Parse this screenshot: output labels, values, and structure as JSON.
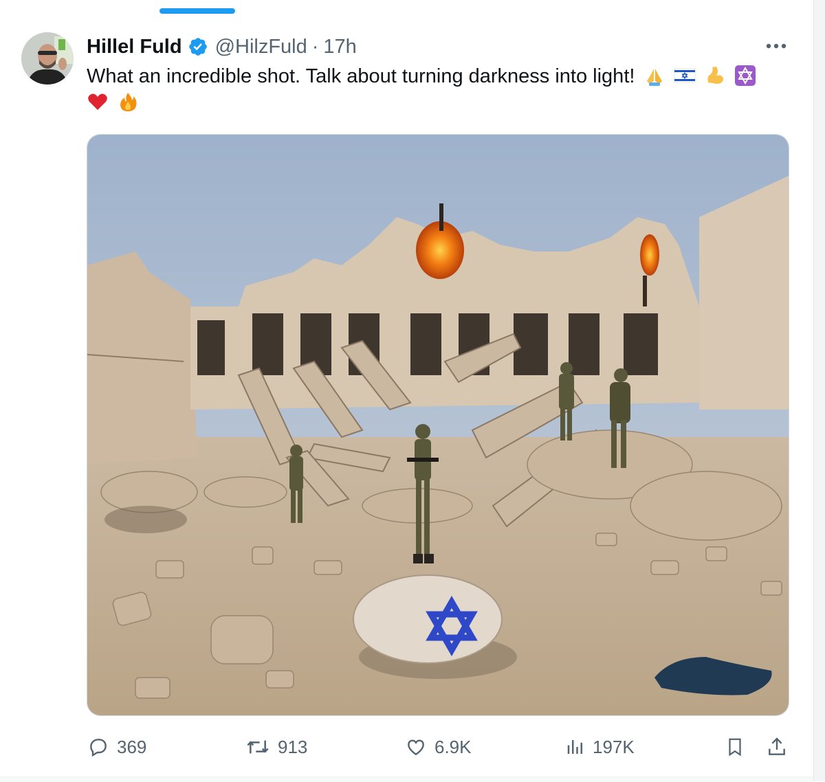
{
  "tweet": {
    "author_name": "Hillel Fuld",
    "handle": "@HilzFuld",
    "separator": "·",
    "time": "17h",
    "text": "What an incredible shot. Talk about turning darkness into light!",
    "emojis": [
      "folded-hands-emoji",
      "israel-flag-emoji",
      "flexed-biceps-emoji",
      "star-of-david-emoji",
      "red-heart-emoji",
      "fire-emoji"
    ],
    "image_alt": "Ruined building with soldiers standing in rubble and a rock painted with a blue Star of David"
  },
  "actions": {
    "replies": "369",
    "reposts": "913",
    "likes": "6.9K",
    "views": "197K"
  },
  "colors": {
    "accent": "#1d9bf0",
    "text_primary": "#0f1419",
    "text_secondary": "#536471",
    "border": "#cfd9de"
  },
  "icons": {
    "verified": "verified-badge-icon",
    "more": "more-icon",
    "reply": "reply-icon",
    "repost": "repost-icon",
    "like": "like-icon",
    "views": "views-icon",
    "bookmark": "bookmark-icon",
    "share": "share-icon"
  }
}
